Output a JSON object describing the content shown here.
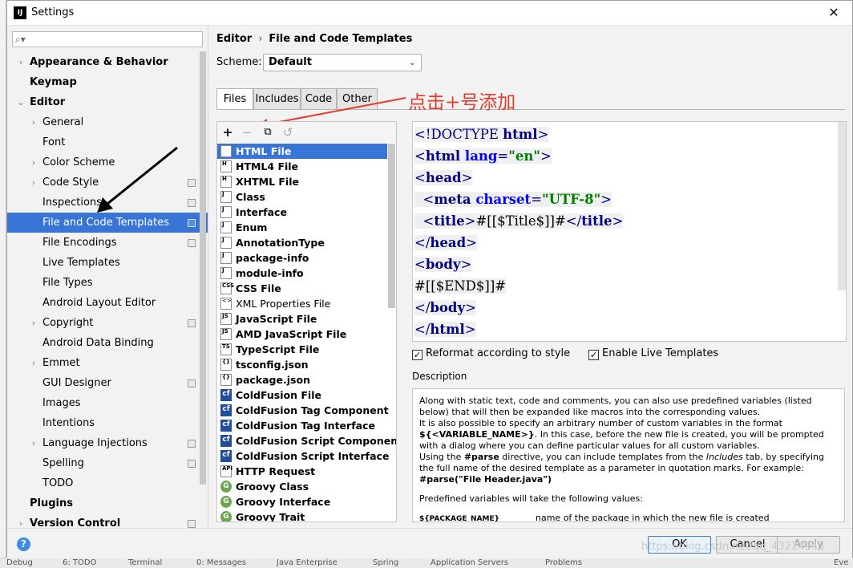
{
  "window": {
    "title": "Settings"
  },
  "search": {
    "placeholder": ""
  },
  "sidebar": {
    "items": [
      {
        "label": "Appearance & Behavior",
        "bold": true,
        "arrow": "›",
        "indent": 0
      },
      {
        "label": "Keymap",
        "bold": true,
        "arrow": "",
        "indent": 0
      },
      {
        "label": "Editor",
        "bold": true,
        "arrow": "⌄",
        "indent": 0
      },
      {
        "label": "General",
        "arrow": "›",
        "indent": 1
      },
      {
        "label": "Font",
        "arrow": "",
        "indent": 1
      },
      {
        "label": "Color Scheme",
        "arrow": "›",
        "indent": 1
      },
      {
        "label": "Code Style",
        "arrow": "›",
        "indent": 1,
        "badge": true
      },
      {
        "label": "Inspections",
        "arrow": "",
        "indent": 1,
        "badge": true
      },
      {
        "label": "File and Code Templates",
        "arrow": "",
        "indent": 1,
        "badge": true,
        "selected": true
      },
      {
        "label": "File Encodings",
        "arrow": "",
        "indent": 1,
        "badge": true
      },
      {
        "label": "Live Templates",
        "arrow": "",
        "indent": 1
      },
      {
        "label": "File Types",
        "arrow": "",
        "indent": 1
      },
      {
        "label": "Android Layout Editor",
        "arrow": "",
        "indent": 1
      },
      {
        "label": "Copyright",
        "arrow": "›",
        "indent": 1,
        "badge": true
      },
      {
        "label": "Android Data Binding",
        "arrow": "",
        "indent": 1
      },
      {
        "label": "Emmet",
        "arrow": "›",
        "indent": 1
      },
      {
        "label": "GUI Designer",
        "arrow": "",
        "indent": 1,
        "badge": true
      },
      {
        "label": "Images",
        "arrow": "",
        "indent": 1
      },
      {
        "label": "Intentions",
        "arrow": "",
        "indent": 1
      },
      {
        "label": "Language Injections",
        "arrow": "›",
        "indent": 1,
        "badge": true
      },
      {
        "label": "Spelling",
        "arrow": "",
        "indent": 1,
        "badge": true
      },
      {
        "label": "TODO",
        "arrow": "",
        "indent": 1
      },
      {
        "label": "Plugins",
        "bold": true,
        "arrow": "",
        "indent": 0
      },
      {
        "label": "Version Control",
        "bold": true,
        "arrow": "›",
        "indent": 0,
        "badge": true
      }
    ]
  },
  "breadcrumb": {
    "parent": "Editor",
    "separator": "›",
    "current": "File and Code Templates"
  },
  "scheme": {
    "label": "Scheme:",
    "value": "Default",
    "chevron": "⌄"
  },
  "tabs": [
    {
      "label": "Files",
      "active": true
    },
    {
      "label": "Includes"
    },
    {
      "label": "Code"
    },
    {
      "label": "Other"
    }
  ],
  "annotation": "点击+号添加",
  "toolbar": {
    "add": "+",
    "remove": "−",
    "copy": "⧉",
    "reset": "↺"
  },
  "files": [
    {
      "name": "HTML File",
      "icon": "H",
      "selected": true
    },
    {
      "name": "HTML4 File",
      "icon": "H"
    },
    {
      "name": "XHTML File",
      "icon": "H"
    },
    {
      "name": "Class",
      "icon": "J"
    },
    {
      "name": "Interface",
      "icon": "J"
    },
    {
      "name": "Enum",
      "icon": "J"
    },
    {
      "name": "AnnotationType",
      "icon": "J"
    },
    {
      "name": "package-info",
      "icon": "J"
    },
    {
      "name": "module-info",
      "icon": "J"
    },
    {
      "name": "CSS File",
      "icon": "CSS"
    },
    {
      "name": "XML Properties File",
      "icon": "<>",
      "plain": true
    },
    {
      "name": "JavaScript File",
      "icon": "JS"
    },
    {
      "name": "AMD JavaScript File",
      "icon": "JS"
    },
    {
      "name": "TypeScript File",
      "icon": "TS"
    },
    {
      "name": "tsconfig.json",
      "icon": "{}"
    },
    {
      "name": "package.json",
      "icon": "{}"
    },
    {
      "name": "ColdFusion File",
      "icon": "cf",
      "kind": "cf"
    },
    {
      "name": "ColdFusion Tag Component",
      "icon": "cf",
      "kind": "cf"
    },
    {
      "name": "ColdFusion Tag Interface",
      "icon": "cf",
      "kind": "cf"
    },
    {
      "name": "ColdFusion Script Component",
      "icon": "cf",
      "kind": "cf"
    },
    {
      "name": "ColdFusion Script Interface",
      "icon": "cf",
      "kind": "cf"
    },
    {
      "name": "HTTP Request",
      "icon": "API"
    },
    {
      "name": "Groovy Class",
      "icon": "G",
      "kind": "round"
    },
    {
      "name": "Groovy Interface",
      "icon": "G",
      "kind": "round"
    },
    {
      "name": "Groovy Trait",
      "icon": "G",
      "kind": "round"
    }
  ],
  "code": {
    "lines": [
      [
        [
          "tag",
          "<!DOCTYPE "
        ],
        [
          "tagname",
          "html"
        ],
        [
          "tag",
          ">"
        ]
      ],
      [
        [
          "tag",
          "<"
        ],
        [
          "tagname",
          "html "
        ],
        [
          "attr",
          "lang"
        ],
        [
          "tag",
          "="
        ],
        [
          "val",
          "\"en\""
        ],
        [
          "tag",
          ">"
        ]
      ],
      [
        [
          "tag",
          "<"
        ],
        [
          "tagname",
          "head"
        ],
        [
          "tag",
          ">"
        ]
      ],
      [
        [
          "txt",
          "  "
        ],
        [
          "tag",
          "<"
        ],
        [
          "tagname",
          "meta "
        ],
        [
          "attr",
          "charset"
        ],
        [
          "tag",
          "="
        ],
        [
          "val",
          "\"UTF-8\""
        ],
        [
          "tag",
          ">"
        ]
      ],
      [
        [
          "txt",
          "  "
        ],
        [
          "tag",
          "<"
        ],
        [
          "tagname",
          "title"
        ],
        [
          "tag",
          ">"
        ],
        [
          "txt",
          "#[[$Title$]]#"
        ],
        [
          "tag",
          "</"
        ],
        [
          "tagname",
          "title"
        ],
        [
          "tag",
          ">"
        ]
      ],
      [
        [
          "tag",
          "</"
        ],
        [
          "tagname",
          "head"
        ],
        [
          "tag",
          ">"
        ]
      ],
      [
        [
          "tag",
          "<"
        ],
        [
          "tagname",
          "body"
        ],
        [
          "tag",
          ">"
        ]
      ],
      [
        [
          "txt",
          "#[[$END$]]#"
        ]
      ],
      [
        [
          "tag",
          "</"
        ],
        [
          "tagname",
          "body"
        ],
        [
          "tag",
          ">"
        ]
      ],
      [
        [
          "tag",
          "</"
        ],
        [
          "tagname",
          "html"
        ],
        [
          "tag",
          ">"
        ]
      ]
    ]
  },
  "options": {
    "reformat": {
      "label": "Reformat according to style",
      "checked": true
    },
    "live_templates": {
      "label": "Enable Live Templates",
      "checked": true
    }
  },
  "description": {
    "label": "Description",
    "p1a": "Along with static text, code and comments, you can also use predefined variables (listed below) that will then be expanded like macros into the corresponding values.",
    "p1b": "It is also possible to specify an arbitrary number of custom variables in the format",
    "p1c": "${<VARIABLE_NAME>}",
    "p1d": ". In this case, before the new file is created, you will be prompted with a dialog where you can define particular values for all custom variables.",
    "p1e": "Using the ",
    "p1f": "#parse",
    "p1g": " directive, you can include templates from the ",
    "p1h": "Includes",
    "p1i": " tab, by specifying the full name of the desired template as a parameter in quotation marks. For example:",
    "p1j": "#parse(\"File Header.java\")",
    "p2": "Predefined variables will take the following values:",
    "var_name": "${PACKAGE_NAME}",
    "var_desc": "name of the package in which the new file is created"
  },
  "buttons": {
    "help": "?",
    "ok": "OK",
    "cancel": "Cancel",
    "apply": "Apply"
  },
  "watermark": "https://blog.csdn.net/qq_43224943",
  "bottom_strip": [
    "Debug",
    "6: TODO",
    "Terminal",
    "0: Messages",
    "Java Enterprise",
    "Spring",
    "Application Servers",
    "Problems",
    "Eve"
  ],
  "colors": {
    "selection": "#3875d7",
    "annotation": "#e53b2c",
    "tag": "#000080",
    "attr": "#0000ff",
    "value": "#008000"
  }
}
